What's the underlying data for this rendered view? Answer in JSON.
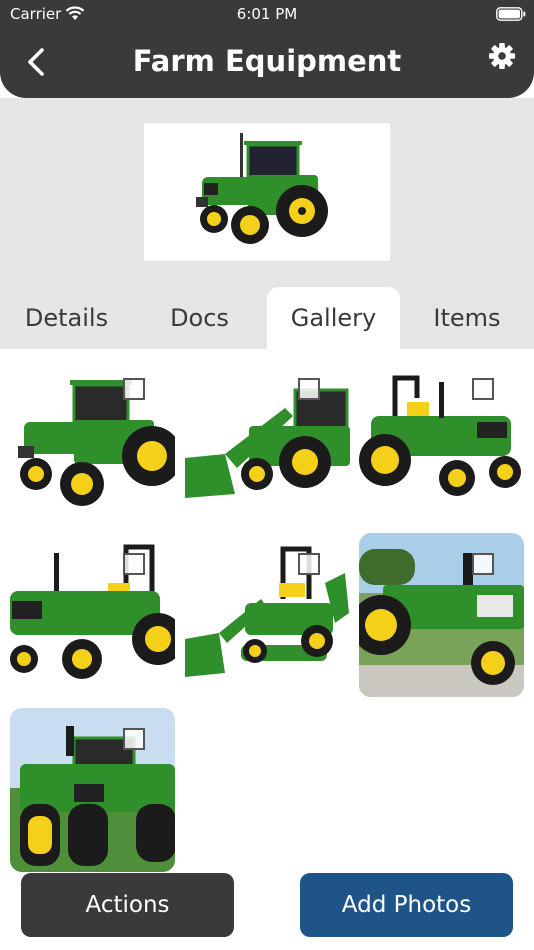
{
  "status_bar": {
    "carrier": "Carrier",
    "time": "6:01 PM"
  },
  "nav": {
    "title": "Farm Equipment"
  },
  "tabs": [
    {
      "label": "Details",
      "active": false
    },
    {
      "label": "Docs",
      "active": false
    },
    {
      "label": "Gallery",
      "active": true
    },
    {
      "label": "Items",
      "active": false
    }
  ],
  "gallery": {
    "items": [
      {
        "subject": "tractor with cab",
        "selected": false
      },
      {
        "subject": "tractor with front loader",
        "selected": false
      },
      {
        "subject": "compact utility tractor",
        "selected": false
      },
      {
        "subject": "utility tractor with canopy frame",
        "selected": false
      },
      {
        "subject": "compact tractor with loader and mower",
        "selected": false
      },
      {
        "subject": "vintage tractor in field",
        "selected": false
      },
      {
        "subject": "large four-wheel-drive tractor",
        "selected": false
      }
    ]
  },
  "buttons": {
    "actions": "Actions",
    "add_photos": "Add Photos"
  },
  "colors": {
    "header": "#3a3a3c",
    "header_area": "#e6e6e6",
    "add_button": "#1e5487",
    "tractor_green": "#2f8f2a",
    "tractor_yellow": "#f5d019"
  }
}
